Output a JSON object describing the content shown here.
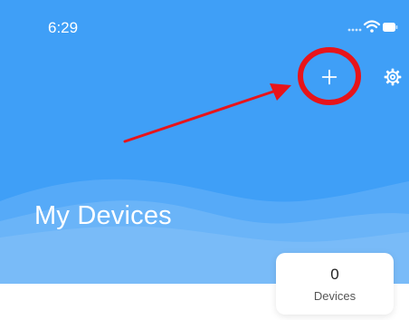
{
  "status_bar": {
    "time": "6:29",
    "icons": [
      "signal-dots-icon",
      "wifi-icon",
      "battery-icon"
    ]
  },
  "toolbar": {
    "add_icon": "plus-icon",
    "settings_icon": "gear-icon"
  },
  "header": {
    "title": "My Devices",
    "background_color": "#3f9ff7"
  },
  "summary_card": {
    "count": "0",
    "label": "Devices"
  },
  "annotation": {
    "circle_color": "#e8141a",
    "arrow_color": "#e8141a"
  }
}
